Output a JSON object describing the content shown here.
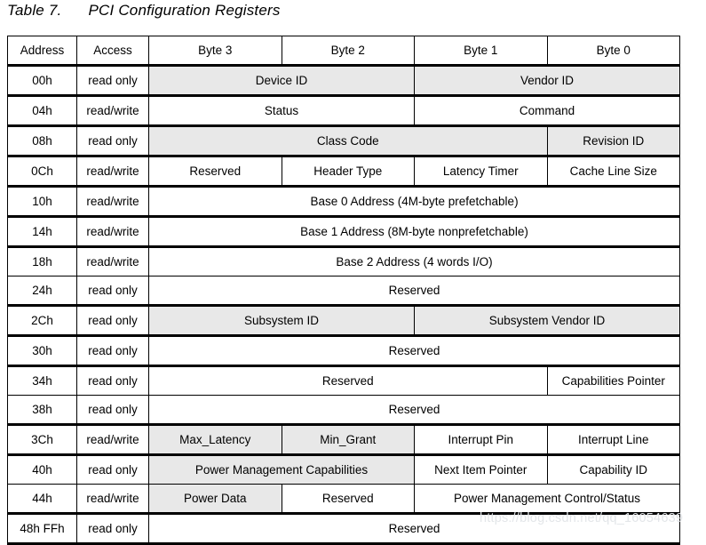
{
  "caption": {
    "label": "Table 7.",
    "title": "PCI Configuration Registers"
  },
  "table": {
    "headers": [
      "Address",
      "Access",
      "Byte 3",
      "Byte 2",
      "Byte 1",
      "Byte 0"
    ],
    "rows": [
      {
        "address": "00h",
        "access": "read only",
        "cells": [
          {
            "text": "Device ID",
            "span": 2,
            "shaded": true
          },
          {
            "text": "Vendor ID",
            "span": 2,
            "shaded": true
          }
        ]
      },
      {
        "address": "04h",
        "access": "read/write",
        "cells": [
          {
            "text": "Status",
            "span": 2,
            "shaded": false
          },
          {
            "text": "Command",
            "span": 2,
            "shaded": false
          }
        ]
      },
      {
        "address": "08h",
        "access": "read only",
        "cells": [
          {
            "text": "Class Code",
            "span": 3,
            "shaded": true
          },
          {
            "text": "Revision ID",
            "span": 1,
            "shaded": true
          }
        ]
      },
      {
        "address": "0Ch",
        "access": "read/write",
        "cells": [
          {
            "text": "Reserved",
            "span": 1,
            "shaded": false
          },
          {
            "text": "Header Type",
            "span": 1,
            "shaded": false
          },
          {
            "text": "Latency Timer",
            "span": 1,
            "shaded": false
          },
          {
            "text": "Cache Line Size",
            "span": 1,
            "shaded": false
          }
        ]
      },
      {
        "address": "10h",
        "access": "read/write",
        "cells": [
          {
            "text": "Base 0 Address (4M-byte prefetchable)",
            "span": 4,
            "shaded": false
          }
        ]
      },
      {
        "address": "14h",
        "access": "read/write",
        "cells": [
          {
            "text": "Base 1 Address (8M-byte nonprefetchable)",
            "span": 4,
            "shaded": false
          }
        ]
      },
      {
        "address": "18h",
        "access": "read/write",
        "cells": [
          {
            "text": "Base 2 Address (4 words I/O)",
            "span": 4,
            "shaded": false
          }
        ]
      },
      {
        "address": "24h",
        "access": "read only",
        "cells": [
          {
            "text": "Reserved",
            "span": 4,
            "shaded": false
          }
        ]
      },
      {
        "address": "2Ch",
        "access": "read only",
        "cells": [
          {
            "text": "Subsystem ID",
            "span": 2,
            "shaded": true
          },
          {
            "text": "Subsystem Vendor ID",
            "span": 2,
            "shaded": true
          }
        ]
      },
      {
        "address": "30h",
        "access": "read only",
        "cells": [
          {
            "text": "Reserved",
            "span": 4,
            "shaded": false
          }
        ]
      },
      {
        "address": "34h",
        "access": "read only",
        "cells": [
          {
            "text": "Reserved",
            "span": 3,
            "shaded": false
          },
          {
            "text": "Capabilities Pointer",
            "span": 1,
            "shaded": false
          }
        ]
      },
      {
        "address": "38h",
        "access": "read only",
        "cells": [
          {
            "text": "Reserved",
            "span": 4,
            "shaded": false
          }
        ]
      },
      {
        "address": "3Ch",
        "access": "read/write",
        "cells": [
          {
            "text": "Max_Latency",
            "span": 1,
            "shaded": true
          },
          {
            "text": "Min_Grant",
            "span": 1,
            "shaded": true
          },
          {
            "text": "Interrupt Pin",
            "span": 1,
            "shaded": false
          },
          {
            "text": "Interrupt Line",
            "span": 1,
            "shaded": false
          }
        ]
      },
      {
        "address": "40h",
        "access": "read only",
        "cells": [
          {
            "text": "Power Management Capabilities",
            "span": 2,
            "shaded": true
          },
          {
            "text": "Next Item Pointer",
            "span": 1,
            "shaded": false
          },
          {
            "text": "Capability ID",
            "span": 1,
            "shaded": false
          }
        ]
      },
      {
        "address": "44h",
        "access": "read/write",
        "cells": [
          {
            "text": "Power Data",
            "span": 1,
            "shaded": true
          },
          {
            "text": "Reserved",
            "span": 1,
            "shaded": false
          },
          {
            "text": "Power Management Control/Status",
            "span": 2,
            "shaded": false
          }
        ]
      },
      {
        "address": "48h FFh",
        "access": "read only",
        "cells": [
          {
            "text": "Reserved",
            "span": 4,
            "shaded": false
          }
        ]
      }
    ]
  },
  "watermark": {
    "text": "https://blog.csdn.net/qq_16054639"
  },
  "colors": {
    "shade": "#e8e8e8",
    "border": "#000000",
    "watermark": "#e3e6e9"
  }
}
